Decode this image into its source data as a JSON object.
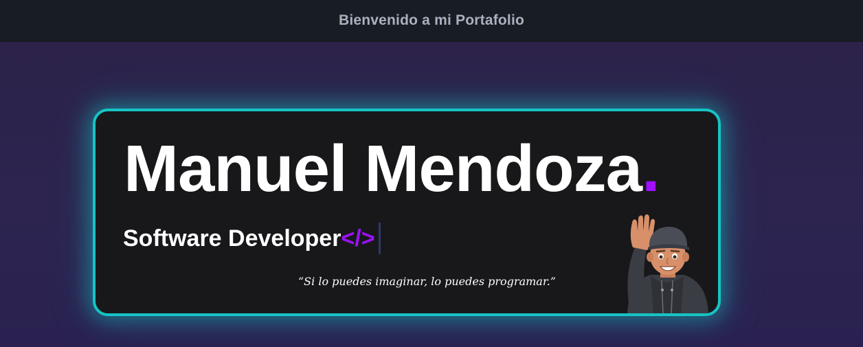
{
  "header": {
    "title": "Bienvenido a mi Portafolio"
  },
  "hero": {
    "name": "Manuel Mendoza",
    "name_dot": ".",
    "role": "Software Developer",
    "role_tag": "</>",
    "quote": "“Si lo puedes imaginar, lo puedes programar.”",
    "avatar_icon": "waving-memoji-icon"
  },
  "colors": {
    "accent_purple": "#a00fff",
    "border_teal": "#16c4c4",
    "header_bg": "#181c23",
    "card_bg": "#18181b"
  }
}
